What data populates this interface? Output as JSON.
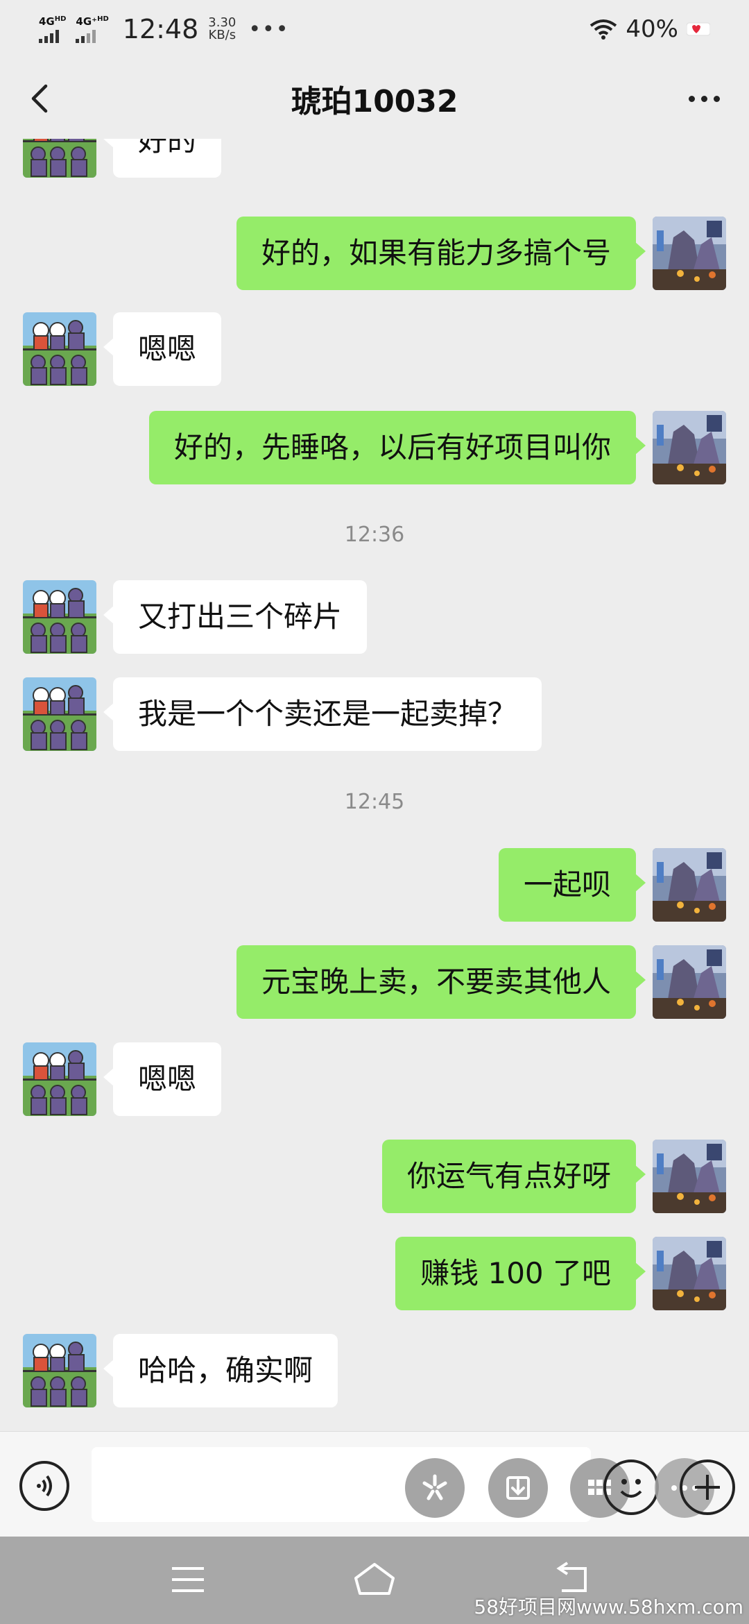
{
  "status_bar": {
    "network_1": "4G",
    "network_1_sup": "HD",
    "network_2": "4G⁺",
    "network_2_sup": "HD",
    "time": "12:48",
    "speed_value": "3.30",
    "speed_unit": "KB/s",
    "dots": "•••",
    "battery": "40%"
  },
  "header": {
    "title": "琥珀10032"
  },
  "messages": [
    {
      "side": "left",
      "text": "好的"
    },
    {
      "side": "right",
      "text": "好的，如果有能力多搞个号"
    },
    {
      "side": "left",
      "text": "嗯嗯"
    },
    {
      "side": "right",
      "text": "好的，先睡咯，以后有好项目叫你"
    },
    {
      "side": "time",
      "text": "12:36"
    },
    {
      "side": "left",
      "text": "又打出三个碎片"
    },
    {
      "side": "left",
      "text": "我是一个个卖还是一起卖掉？"
    },
    {
      "side": "time",
      "text": "12:45"
    },
    {
      "side": "right",
      "text": "一起呗"
    },
    {
      "side": "right",
      "text": "元宝晚上卖，不要卖其他人"
    },
    {
      "side": "left",
      "text": "嗯嗯"
    },
    {
      "side": "right",
      "text": "你运气有点好呀"
    },
    {
      "side": "right",
      "text": "赚钱 100 了吧"
    },
    {
      "side": "left",
      "text": "哈哈，确实啊"
    }
  ],
  "input_bar": {
    "placeholder": ""
  },
  "watermark": "58好项目网www.58hxm.com",
  "colors": {
    "background": "#ededed",
    "outgoing_bubble": "#95ec69",
    "incoming_bubble": "#ffffff",
    "nav_bar": "#a8a8a8"
  }
}
